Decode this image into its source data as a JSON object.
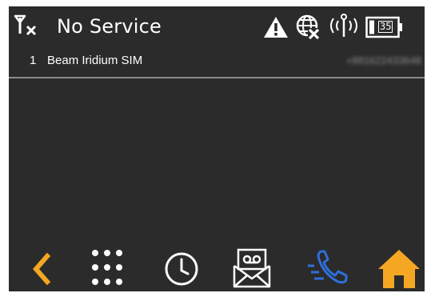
{
  "status_bar": {
    "signal_icon": "no-signal-icon",
    "title": "No Service",
    "icons": [
      "warning-icon",
      "no-network-globe-icon",
      "antenna-icon",
      "battery-icon"
    ],
    "battery_label": "35"
  },
  "sim_list": {
    "items": [
      {
        "index": "1",
        "name": "Beam Iridium SIM",
        "number": "+881622433648"
      }
    ]
  },
  "nav_bar": {
    "buttons": [
      {
        "name": "back",
        "icon": "chevron-left-icon",
        "color": "#f5a623"
      },
      {
        "name": "dialpad",
        "icon": "dialpad-icon",
        "color": "#ffffff"
      },
      {
        "name": "call-log",
        "icon": "clock-icon",
        "color": "#ffffff"
      },
      {
        "name": "voicemail",
        "icon": "voicemail-envelope-icon",
        "color": "#ffffff"
      },
      {
        "name": "phone",
        "icon": "phone-call-icon",
        "color": "#2f6fdb"
      },
      {
        "name": "home",
        "icon": "home-icon",
        "color": "#f5a623"
      }
    ]
  },
  "colors": {
    "background": "#2b2b2b",
    "accent_orange": "#f5a623",
    "accent_blue": "#2f6fdb"
  }
}
